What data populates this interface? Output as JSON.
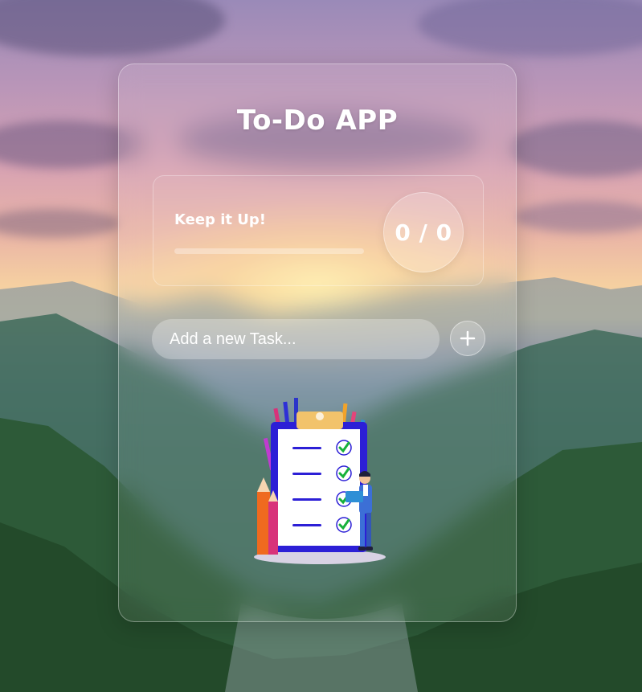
{
  "app": {
    "title": "To-Do APP"
  },
  "stats": {
    "message": "Keep it Up!",
    "progress": 0,
    "counter": "0 / 0"
  },
  "task_input": {
    "placeholder": "Add a new Task...",
    "value": ""
  },
  "add_button": {
    "icon": "plus-icon"
  },
  "illustration": {
    "icon": "checklist-clipboard-illustration"
  },
  "colors": {
    "text": "#ffffff",
    "clipboard_border": "#2c1fd6",
    "clipboard_clip": "#f2c36b",
    "check_green": "#17b13a"
  }
}
